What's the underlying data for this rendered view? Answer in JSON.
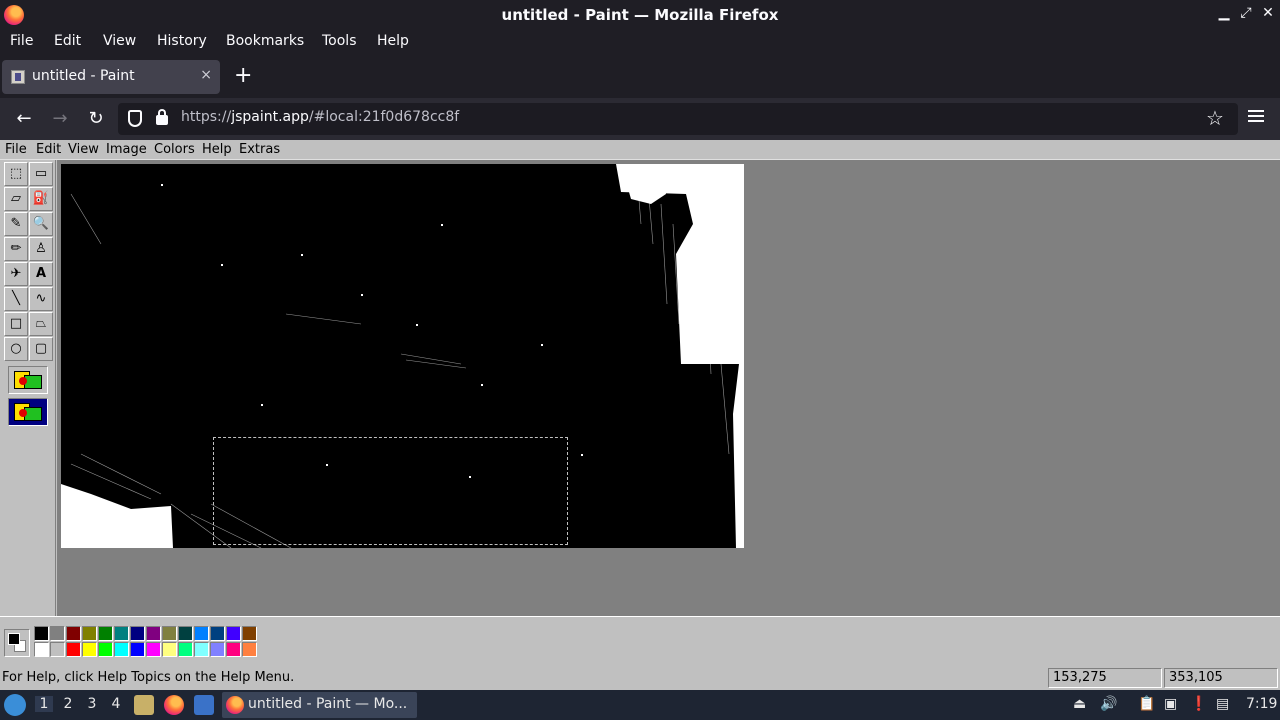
{
  "window": {
    "title": "untitled - Paint — Mozilla Firefox"
  },
  "ff_menu": [
    "File",
    "Edit",
    "View",
    "History",
    "Bookmarks",
    "Tools",
    "Help"
  ],
  "tab": {
    "title": "untitled - Paint",
    "close": "×",
    "new_tab": "+"
  },
  "nav": {
    "back": "←",
    "forward": "→",
    "reload": "↻",
    "url_prefix": "https://",
    "url_domain": "jspaint.app",
    "url_path": "/#local:21f0d678cc8f",
    "bookmark": "☆"
  },
  "paint_menu": [
    "File",
    "Edit",
    "View",
    "Image",
    "Colors",
    "Help",
    "Extras"
  ],
  "tools": [
    {
      "name": "free-form-select-tool",
      "glyph": "⬚"
    },
    {
      "name": "select-tool",
      "glyph": "▭"
    },
    {
      "name": "eraser-tool",
      "glyph": "▱"
    },
    {
      "name": "fill-tool",
      "glyph": "⛽"
    },
    {
      "name": "pick-color-tool",
      "glyph": "✎"
    },
    {
      "name": "magnifier-tool",
      "glyph": "🔍"
    },
    {
      "name": "pencil-tool",
      "glyph": "✏"
    },
    {
      "name": "brush-tool",
      "glyph": "♙"
    },
    {
      "name": "airbrush-tool",
      "glyph": "✈"
    },
    {
      "name": "text-tool",
      "glyph": "A"
    },
    {
      "name": "line-tool",
      "glyph": "╲"
    },
    {
      "name": "curve-tool",
      "glyph": "∿"
    },
    {
      "name": "rectangle-tool",
      "glyph": "□"
    },
    {
      "name": "polygon-tool",
      "glyph": "⏢"
    },
    {
      "name": "ellipse-tool",
      "glyph": "○"
    },
    {
      "name": "rounded-rectangle-tool",
      "glyph": "▢"
    }
  ],
  "palette": {
    "top": [
      "#000000",
      "#808080",
      "#800000",
      "#808000",
      "#008000",
      "#008080",
      "#000080",
      "#800080",
      "#808040",
      "#004040",
      "#0080ff",
      "#004080",
      "#4000ff",
      "#804000"
    ],
    "bottom": [
      "#ffffff",
      "#c0c0c0",
      "#ff0000",
      "#ffff00",
      "#00ff00",
      "#00ffff",
      "#0000ff",
      "#ff00ff",
      "#ffff80",
      "#00ff80",
      "#80ffff",
      "#8080ff",
      "#ff0080",
      "#ff8040"
    ]
  },
  "status": {
    "message": "For Help, click Help Topics on the Help Menu.",
    "cursor": "153,275",
    "selection_size": "353,105"
  },
  "taskbar": {
    "workspaces": [
      "1",
      "2",
      "3",
      "4"
    ],
    "task_label": "untitled - Paint — Mo...",
    "clock": "7:19"
  }
}
